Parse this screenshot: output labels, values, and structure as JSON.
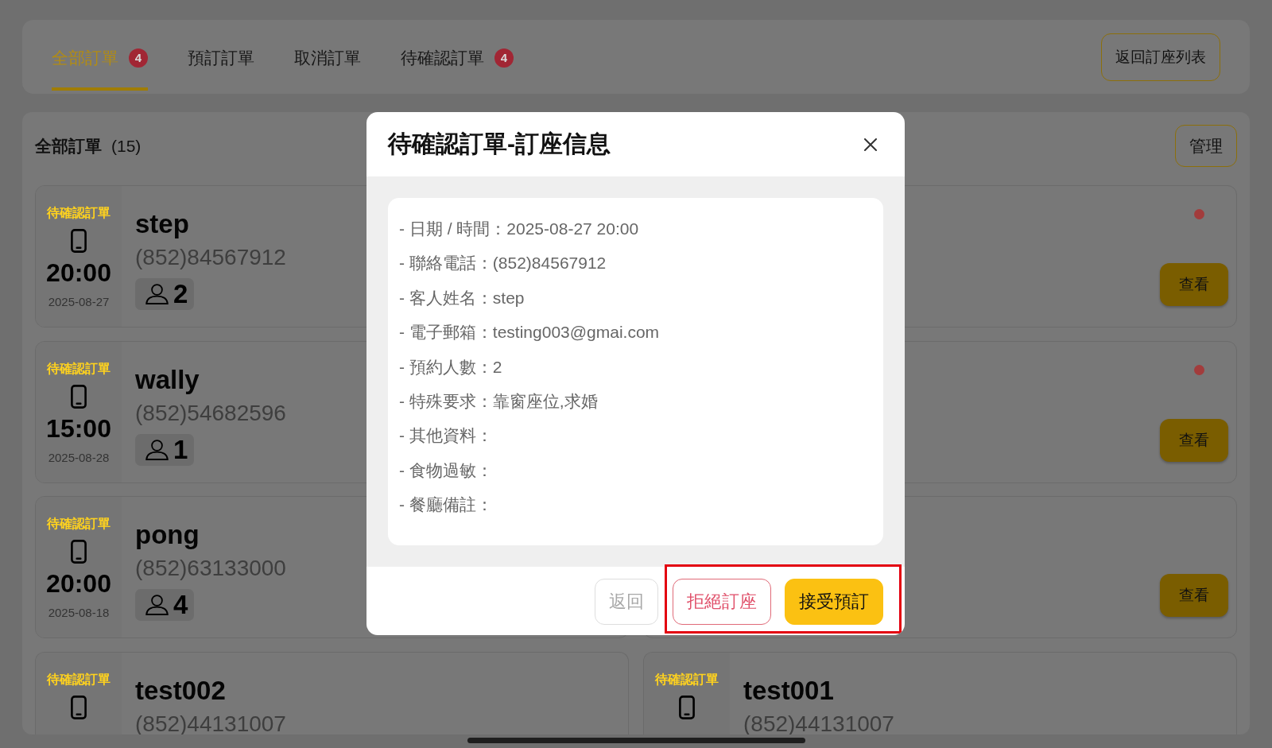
{
  "tabs": [
    {
      "label": "全部訂單",
      "selected": true,
      "badge": "4"
    },
    {
      "label": "預訂訂單",
      "selected": false
    },
    {
      "label": "取消訂單",
      "selected": false
    },
    {
      "label": "待確認訂單",
      "selected": false,
      "badge": "4"
    }
  ],
  "back_button": "返回訂座列表",
  "list": {
    "title": "全部訂單",
    "count": "(15)",
    "manage_button": "管理",
    "orders": [
      {
        "status": "待確認訂單",
        "time": "20:00",
        "date": "2025-08-27",
        "name": "step",
        "phone": "(852)84567912",
        "guests": "2"
      },
      {
        "unread": true,
        "action": "查看"
      },
      {
        "status": "待確認訂單",
        "time": "15:00",
        "date": "2025-08-28",
        "name": "wally",
        "phone": "(852)54682596",
        "guests": "1"
      },
      {
        "unread": true,
        "action": "查看"
      },
      {
        "status": "待確認訂單",
        "time": "20:00",
        "date": "2025-08-18",
        "name": "pong",
        "phone": "(852)63133000",
        "guests": "4"
      },
      {
        "unread": false,
        "action": "查看"
      },
      {
        "status": "待確認訂單",
        "name": "test002",
        "phone": "(852)44131007",
        "unread": false
      },
      {
        "status": "待確認訂單",
        "name": "test001",
        "phone": "(852)44131007",
        "unread": false
      }
    ]
  },
  "dialog": {
    "title": "待確認訂單-訂座信息",
    "details": [
      "- 日期 / 時間：2025-08-27 20:00",
      "- 聯絡電話：(852)84567912",
      "- 客人姓名：step",
      "- 電子郵箱：testing003@gmai.com",
      "- 預約人數：2",
      "- 特殊要求：靠窗座位,求婚",
      "- 其他資料：",
      "- 食物過敏：",
      "- 餐廳備註："
    ],
    "buttons": [
      {
        "label": "返回",
        "kind": "secondary",
        "highlighted": false
      },
      {
        "label": "拒絕訂座",
        "kind": "danger",
        "highlighted": true
      },
      {
        "label": "接受預訂",
        "kind": "primary",
        "highlighted": true
      }
    ]
  }
}
